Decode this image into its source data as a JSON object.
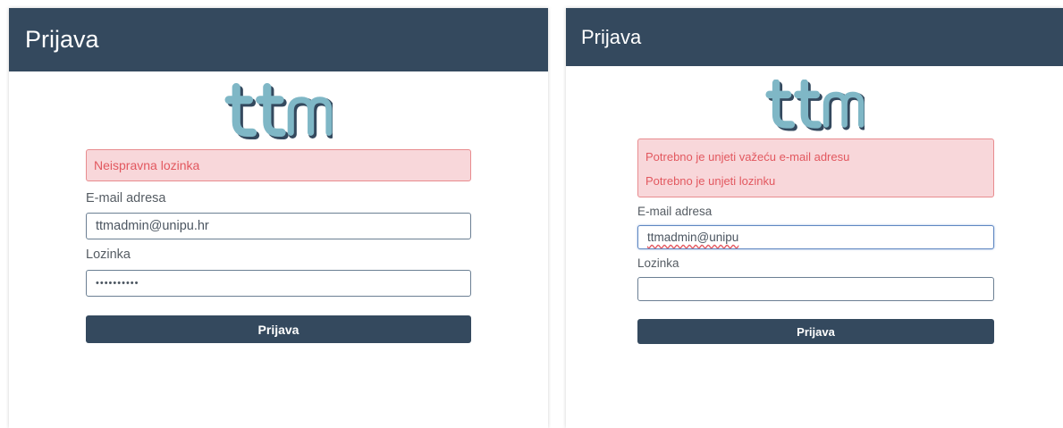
{
  "brand": "ttm",
  "colors": {
    "header_bg": "#34495e",
    "alert_bg": "#f8d7da",
    "alert_text": "#e2585f",
    "logo_light": "#7fb7c6",
    "logo_dark": "#34495e"
  },
  "left": {
    "title": "Prijava",
    "alert_message": "Neispravna lozinka",
    "email_label": "E-mail adresa",
    "email_value": "ttmadmin@unipu.hr",
    "password_label": "Lozinka",
    "password_value": "••••••••••",
    "submit_label": "Prijava"
  },
  "right": {
    "title": "Prijava",
    "alert_messages": [
      "Potrebno je unjeti važeću e-mail adresu",
      "Potrebno je unjeti lozinku"
    ],
    "email_label": "E-mail adresa",
    "email_value": "ttmadmin@unipu",
    "password_label": "Lozinka",
    "password_value": "",
    "submit_label": "Prijava"
  }
}
